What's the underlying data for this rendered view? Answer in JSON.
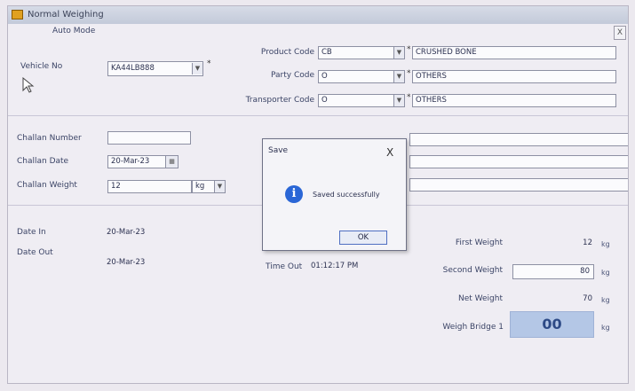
{
  "window": {
    "title": "Normal Weighing",
    "close_label": "X"
  },
  "mode": "Auto Mode",
  "vehicle": {
    "label": "Vehicle No",
    "value": "KA44LB888",
    "required": "*"
  },
  "product": {
    "label": "Product Code",
    "code": "CB",
    "name": "CRUSHED BONE",
    "required": "*"
  },
  "party": {
    "label": "Party Code",
    "code": "O",
    "name": "OTHERS",
    "required": "*"
  },
  "transporter": {
    "label": "Transporter Code",
    "code": "O",
    "name": "OTHERS",
    "required": "*"
  },
  "challan": {
    "number_label": "Challan Number",
    "number_value": "",
    "date_label": "Challan Date",
    "date_value": "20-Mar-23",
    "weight_label": "Challan Weight",
    "weight_value": "12",
    "weight_unit": "kg"
  },
  "date_in": {
    "label": "Date In",
    "value": "20-Mar-23"
  },
  "date_out": {
    "label": "Date Out",
    "value": "20-Mar-23"
  },
  "time_out": {
    "label": "Time Out",
    "value": "01:12:17 PM"
  },
  "weights": {
    "first_label": "First Weight",
    "first_value": "12",
    "first_unit": "kg",
    "second_label": "Second Weight",
    "second_value": "80",
    "second_unit": "kg",
    "net_label": "Net Weight",
    "net_value": "70",
    "net_unit": "kg",
    "bridge_label": "Weigh Bridge 1",
    "bridge_value": "00",
    "bridge_unit": "kg"
  },
  "dialog": {
    "title": "Save",
    "close": "X",
    "message": "Saved successfully",
    "ok_label": "OK",
    "icon": "info-icon"
  },
  "colors": {
    "dialog_icon": "#2a66d6",
    "weigh_display": "#b4c7e6"
  }
}
